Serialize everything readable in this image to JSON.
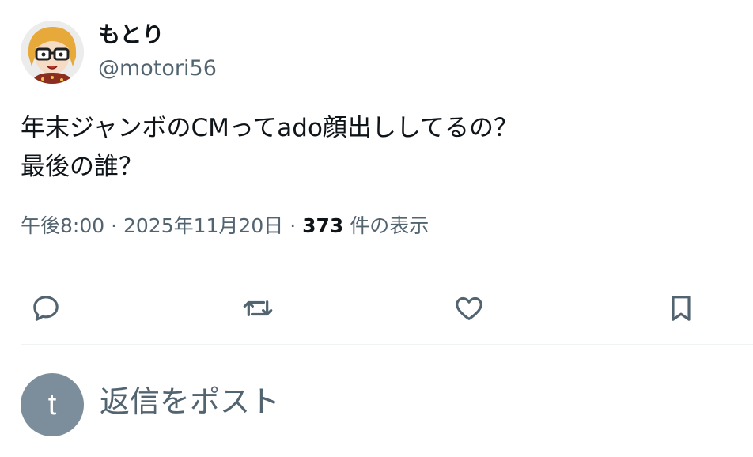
{
  "author": {
    "display_name": "もとり",
    "handle": "@motori56"
  },
  "post": {
    "lines": [
      "年末ジャンボのCMってado顔出ししてるの？",
      "最後の誰？"
    ],
    "time": "午後8:00",
    "separator": "·",
    "date": "2025年11月20日",
    "views_count": "373",
    "views_label": "件の表示"
  },
  "actions": {
    "reply_icon": "reply-icon",
    "repost_icon": "repost-icon",
    "like_icon": "like-icon",
    "bookmark_icon": "bookmark-icon"
  },
  "reply_box": {
    "avatar_letter": "t",
    "placeholder": "返信をポスト"
  },
  "colors": {
    "text_primary": "#0f1419",
    "text_secondary": "#536471",
    "divider": "#eff3f4",
    "reply_avatar_bg": "#7c8e9c"
  }
}
